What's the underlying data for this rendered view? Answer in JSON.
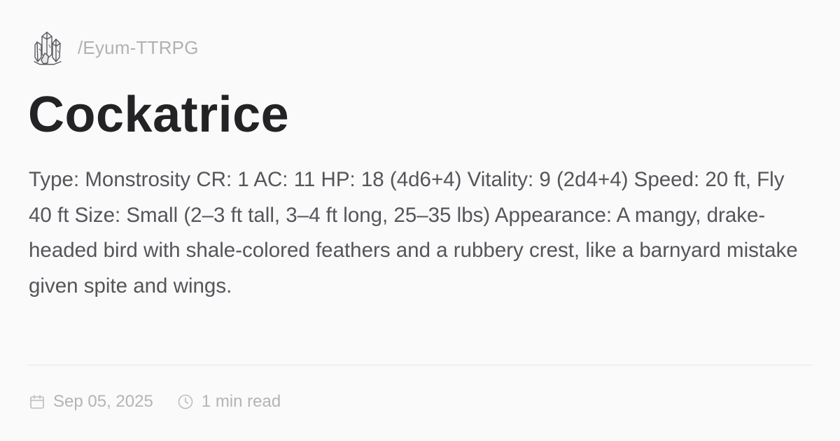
{
  "site": {
    "logo_icon": "crystal-cluster-icon",
    "path": "/Eyum-TTRPG"
  },
  "post": {
    "title": "Cockatrice",
    "description": "Type: Monstrosity CR: 1 AC: 11 HP: 18 (4d6+4) Vitality: 9 (2d4+4) Speed: 20 ft, Fly 40 ft Size: Small (2–3 ft tall, 3–4 ft long, 25–35 lbs) Appearance: A mangy, drake-headed bird with shale-colored feathers and a rubbery crest, like a barnyard mistake given spite and wings.",
    "date_icon": "calendar-icon",
    "date": "Sep 05, 2025",
    "read_icon": "clock-icon",
    "read_time": "1 min read"
  },
  "colors": {
    "background": "#fafafb",
    "title": "#232325",
    "body_text": "#55555a",
    "muted": "#b4b4b8"
  }
}
